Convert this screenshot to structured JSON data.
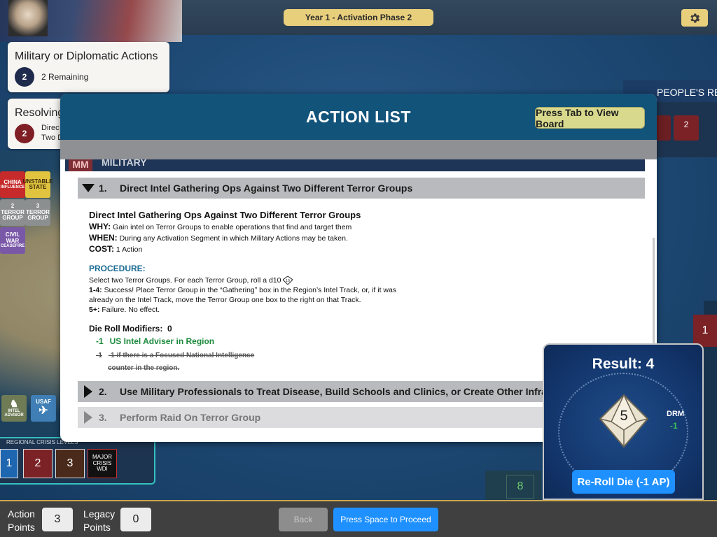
{
  "header": {
    "phase": "Year 1  -  Activation Phase 2",
    "settings_icon": "gear-icon"
  },
  "action_cards": [
    {
      "title": "Military or Diplomatic Actions",
      "count": "2",
      "sub": "2 Remaining",
      "color": "#1f2b4d"
    },
    {
      "title": "Resolving",
      "count": "2",
      "sub_line1": "Direc",
      "sub_line2": "Two D",
      "color": "#7f1f25"
    }
  ],
  "left_tiles": [
    {
      "line1": "CHINA",
      "line2": "INFLUENCE",
      "color": "#c62a2a"
    },
    {
      "line1": "UNSTABLE",
      "line2": "STATE",
      "color": "#e0c33f"
    },
    {
      "line1": "2",
      "line2": "TERROR",
      "line3": "GROUP",
      "color": "#8c8f8f"
    },
    {
      "line1": "3",
      "line2": "TERROR",
      "line3": "GROUP",
      "color": "#8c8f8f"
    },
    {
      "line1": "CIVIL",
      "line2": "WAR",
      "line3": "CEASEFIRE",
      "color": "#7a58a8"
    },
    {
      "line1": "INTEL",
      "line2": "ADVISOR",
      "color": "#6e7b55"
    },
    {
      "line1": "USAF",
      "line2": "",
      "color": "#3f7fb5"
    }
  ],
  "crisis": {
    "label": "REGIONAL CRISIS LEVELS",
    "levels": [
      {
        "value": "1",
        "color": "#1e66b0"
      },
      {
        "value": "2",
        "color": "#7b2226"
      },
      {
        "value": "3",
        "color": "#4a2b1b"
      },
      {
        "value": "MAJOR\nCRISIS\nWDI",
        "color": "#111111"
      }
    ]
  },
  "right_panel": {
    "title": "PEOPLE'S REP",
    "values": [
      "2",
      "2"
    ],
    "side_value": "1",
    "counter": "8"
  },
  "modal": {
    "title": "ACTION LIST",
    "tab_button": "Press Tab to View Board",
    "section_code": "MM",
    "section_name": "MILITARY",
    "items": [
      {
        "num": "1.",
        "label": "Direct Intel Gathering Ops Against Two Different Terror Groups",
        "expanded": true
      },
      {
        "num": "2.",
        "label": "Use Military Professionals to Treat Disease, Build Schools and Clinics, or Create Other Infrastructure in",
        "expanded": false
      },
      {
        "num": "3.",
        "label": "Perform Raid On Terror Group",
        "expanded": false,
        "disabled": true
      }
    ],
    "detail": {
      "heading": "Direct Intel Gathering Ops Against Two Different Terror Groups",
      "why_label": "WHY:",
      "why": "Gain intel on Terror Groups to enable operations that find and target them",
      "when_label": "WHEN:",
      "when": "During any Activation Segment in which Military Actions may be taken.",
      "cost_label": "COST:",
      "cost": "1 Action",
      "procedure_label": "PROCEDURE:",
      "proc_1": "Select two Terror Groups. For each Terror Group, roll a d10",
      "proc_2_label": "1-4:",
      "proc_2": "Success! Place Terror Group in the “Gathering” box in the Region’s Intel Track, or, if it was",
      "proc_2b": "already on the Intel Track, move the Terror Group one box to the right on that Track.",
      "proc_3_label": "5+:",
      "proc_3": "Failure. No effect.",
      "drm_label": "Die Roll Modifiers:",
      "drm_value": "0",
      "mod_1_value": "-1",
      "mod_1_text": "US Intel Adviser in Region",
      "mod_2_value": "-1",
      "mod_2_text": "-1 if there is a Focused National Intelligence",
      "mod_2_text_b": "counter in the region."
    }
  },
  "dice": {
    "result": "Result: 4",
    "die_value": "5",
    "drm_label": "DRM",
    "drm_value": "-1",
    "reroll": "Re-Roll Die (-1 AP)"
  },
  "bottom": {
    "action_points_label_1": "Action",
    "action_points_label_2": "Points",
    "action_points": "3",
    "legacy_points_label_1": "Legacy",
    "legacy_points_label_2": "Points",
    "legacy_points": "0",
    "back": "Back",
    "proceed": "Press Space to Proceed"
  }
}
